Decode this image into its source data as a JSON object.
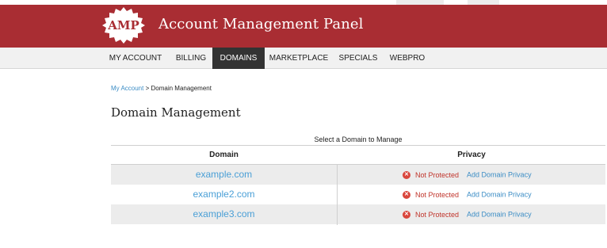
{
  "header": {
    "logo_text": "AMP",
    "title": "Account Management Panel"
  },
  "nav": {
    "items": [
      {
        "label": "MY ACCOUNT",
        "active": false
      },
      {
        "label": "BILLING",
        "active": false
      },
      {
        "label": "DOMAINS",
        "active": true
      },
      {
        "label": "MARKETPLACE",
        "active": false
      },
      {
        "label": "SPECIALS",
        "active": false
      },
      {
        "label": "WEBPRO",
        "active": false
      }
    ]
  },
  "breadcrumb": {
    "link": "My Account",
    "separator": " > ",
    "current": "Domain Management"
  },
  "page_title": "Domain Management",
  "table": {
    "caption": "Select a Domain to Manage",
    "headers": [
      "Domain",
      "Privacy"
    ],
    "rows": [
      {
        "domain": "example.com",
        "status": "Not Protected",
        "action": "Add Domain Privacy"
      },
      {
        "domain": "example2.com",
        "status": "Not Protected",
        "action": "Add Domain Privacy"
      },
      {
        "domain": "example3.com",
        "status": "Not Protected",
        "action": "Add Domain Privacy"
      }
    ]
  },
  "colors": {
    "header_bg": "#a92d33",
    "nav_active_bg": "#333333",
    "link": "#3c8dc5",
    "danger": "#d9463c"
  },
  "icons": {
    "status_icon": "x-circle-icon"
  }
}
